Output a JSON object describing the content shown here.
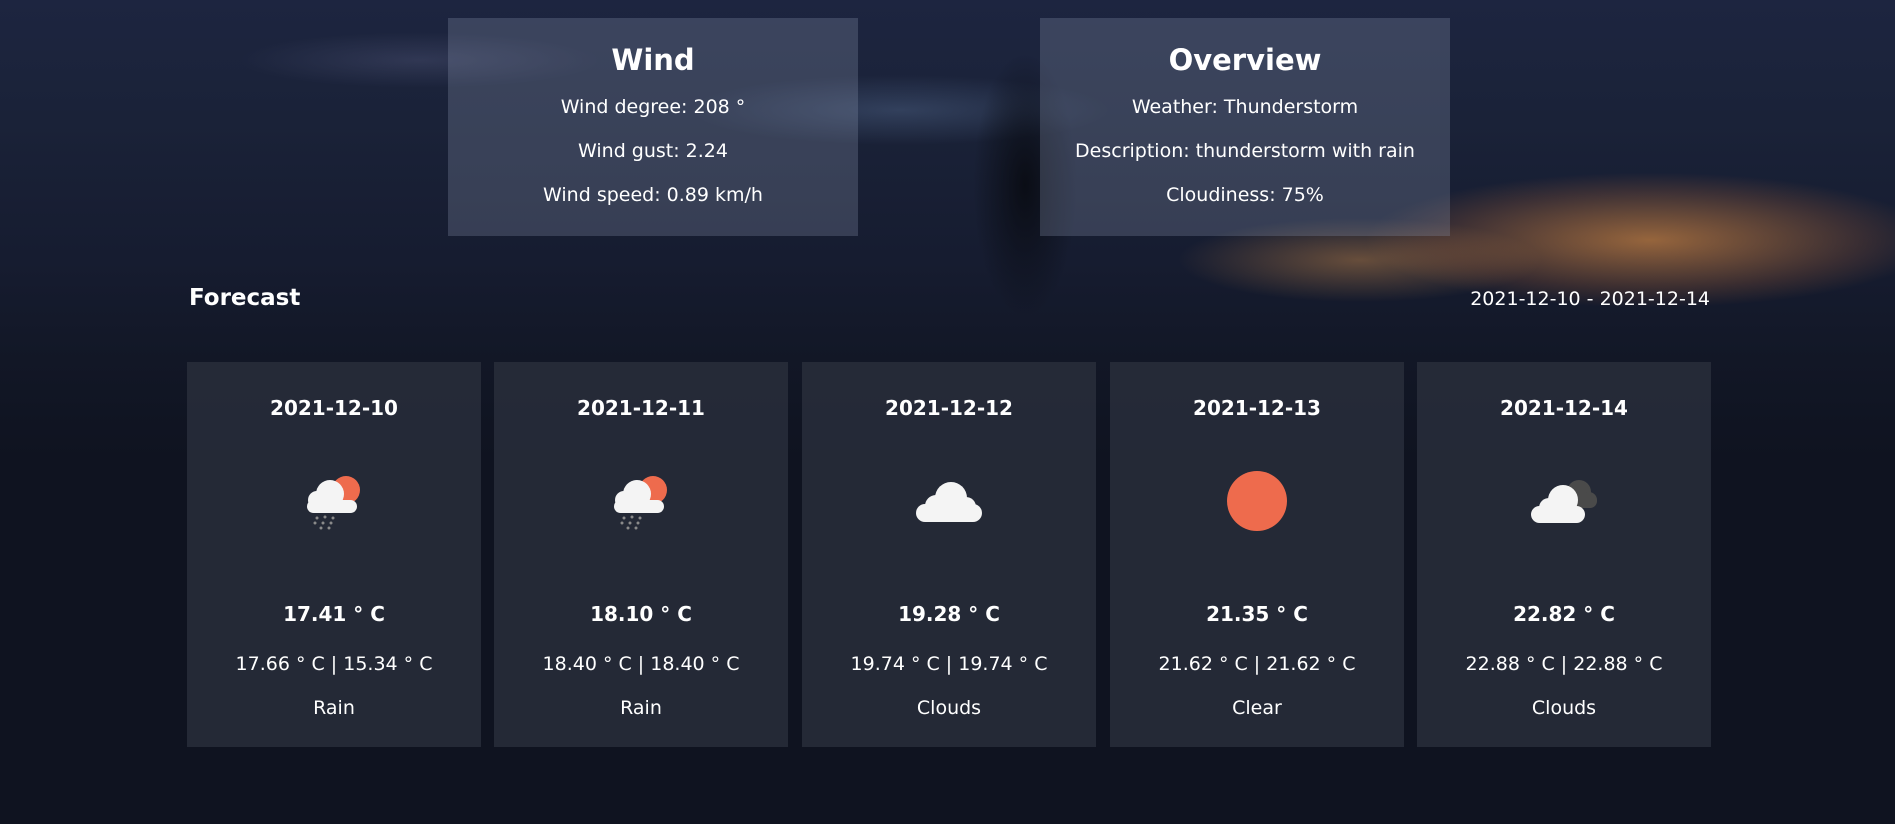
{
  "wind": {
    "title": "Wind",
    "degree": "Wind degree: 208 °",
    "gust": "Wind gust: 2.24",
    "speed": "Wind speed: 0.89 km/h"
  },
  "overview": {
    "title": "Overview",
    "weather": "Weather: Thunderstorm",
    "description": "Description: thunderstorm with rain",
    "cloudiness": "Cloudiness: 75%"
  },
  "forecast": {
    "title": "Forecast",
    "range": "2021-12-10 - 2021-12-14",
    "days": [
      {
        "date": "2021-12-10",
        "icon": "rain-sun-cloud-icon",
        "temp": "17.41 ° C",
        "minmax": "17.66 ° C | 15.34 ° C",
        "desc": "Rain"
      },
      {
        "date": "2021-12-11",
        "icon": "rain-sun-cloud-icon",
        "temp": "18.10 ° C",
        "minmax": "18.40 ° C | 18.40 ° C",
        "desc": "Rain"
      },
      {
        "date": "2021-12-12",
        "icon": "cloud-icon",
        "temp": "19.28 ° C",
        "minmax": "19.74 ° C | 19.74 ° C",
        "desc": "Clouds"
      },
      {
        "date": "2021-12-13",
        "icon": "sun-icon",
        "temp": "21.35 ° C",
        "minmax": "21.62 ° C | 21.62 ° C",
        "desc": "Clear"
      },
      {
        "date": "2021-12-14",
        "icon": "dark-clouds-icon",
        "temp": "22.82 ° C",
        "minmax": "22.88 ° C | 22.88 ° C",
        "desc": "Clouds"
      }
    ]
  },
  "colors": {
    "sun": "#ee6b4d",
    "cloud": "#f4f4f4",
    "dark_cloud": "#4a4a4a"
  }
}
